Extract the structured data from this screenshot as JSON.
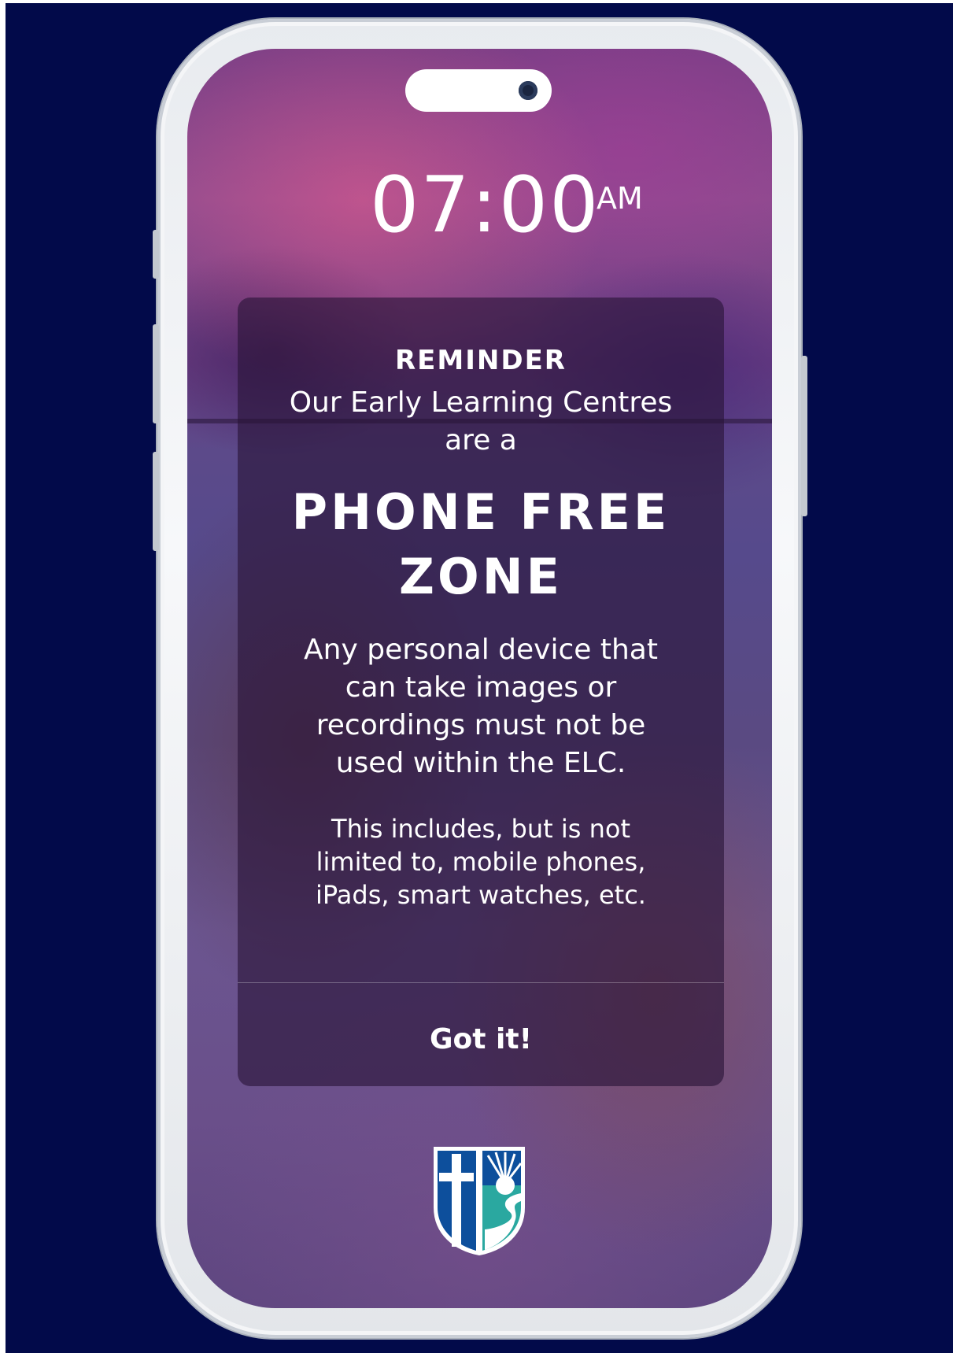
{
  "lockscreen": {
    "time": "07:00",
    "ampm": "AM"
  },
  "notice": {
    "label": "REMINDER",
    "subtitle_line1": "Our Early Learning Centres",
    "subtitle_line2": "are a",
    "headline_line1": "PHONE FREE",
    "headline_line2": "ZONE",
    "body_line1": "Any personal device that",
    "body_line2": "can take images or",
    "body_line3": "recordings must not be",
    "body_line4": "used within the ELC.",
    "note_line1": "This includes, but is not",
    "note_line2": "limited to, mobile phones,",
    "note_line3": "iPads, smart watches, etc.",
    "dismiss_label": "Got it!"
  },
  "branding": {
    "logo_icon": "school-crest-icon",
    "colors": {
      "blue": "#0d4f9c",
      "teal": "#2aa8a0",
      "navy": "#020a4a"
    }
  }
}
